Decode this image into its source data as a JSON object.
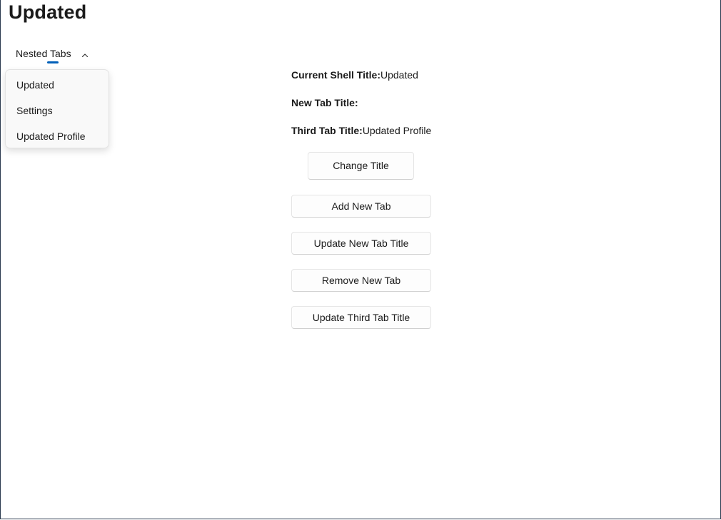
{
  "page": {
    "title": "Updated"
  },
  "nav": {
    "tab_label": "Nested Tabs",
    "chevron_icon": "chevron-up-icon",
    "accent_color": "#005fb8",
    "flyout_items": [
      {
        "label": "Updated"
      },
      {
        "label": "Settings"
      },
      {
        "label": "Updated Profile"
      }
    ]
  },
  "info": {
    "current_shell_title_label": "Current Shell Title:",
    "current_shell_title_value": "Updated",
    "new_tab_title_label": "New Tab Title:",
    "new_tab_title_value": "",
    "third_tab_title_label": "Third Tab Title:",
    "third_tab_title_value": "Updated Profile"
  },
  "actions": {
    "change_title": "Change Title",
    "add_new_tab": "Add New Tab",
    "update_new_tab_title": "Update New Tab Title",
    "remove_new_tab": "Remove New Tab",
    "update_third_tab_title": "Update Third Tab Title"
  }
}
